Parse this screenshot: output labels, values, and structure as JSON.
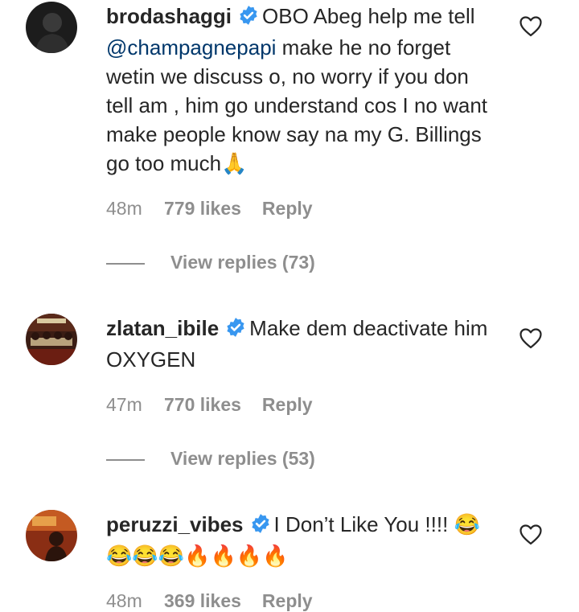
{
  "comments": [
    {
      "username": "brodashaggi",
      "verified": true,
      "text_before": "OBO Abeg help me tell ",
      "mention": "@champagnepapi",
      "text_after": " make he no forget wetin we discuss o, no worry if you don tell am , him go understand cos I no want make people know say na my G. Billings go too much🙏",
      "time": "48m",
      "likes": "779 likes",
      "reply_label": "Reply",
      "view_replies": "View replies (73)"
    },
    {
      "username": "zlatan_ibile",
      "verified": true,
      "text": "Make dem deactivate him OXYGEN",
      "time": "47m",
      "likes": "770 likes",
      "reply_label": "Reply",
      "view_replies": "View replies (53)"
    },
    {
      "username": "peruzzi_vibes",
      "verified": true,
      "text": "I Don’t Like You !!!! 😂😂😂😂🔥🔥🔥🔥",
      "time": "48m",
      "likes": "369 likes",
      "reply_label": "Reply"
    }
  ],
  "colors": {
    "text": "#262626",
    "secondary": "#8e8e8e",
    "mention": "#00376b",
    "verified": "#3897f0"
  },
  "icons": [
    "verified-badge-icon",
    "heart-outline-icon"
  ]
}
